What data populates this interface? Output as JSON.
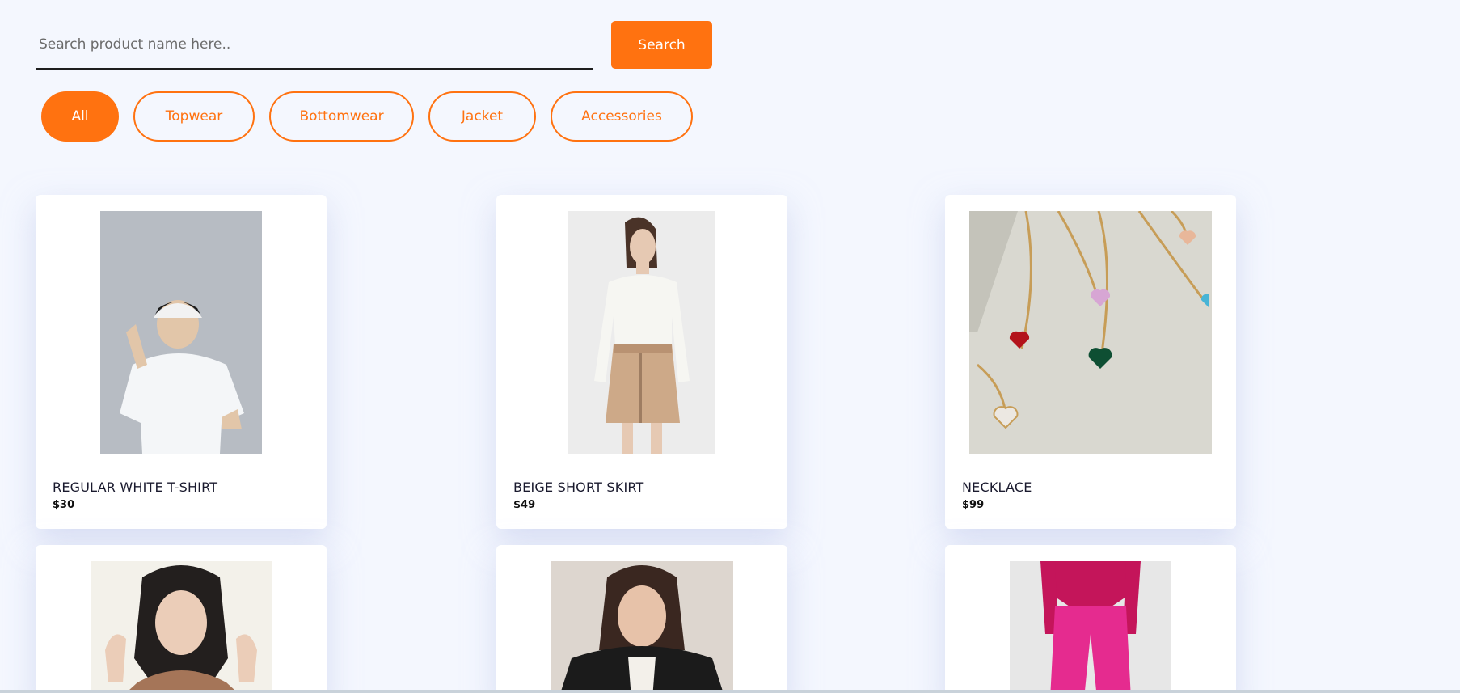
{
  "search": {
    "placeholder": "Search product name here..",
    "button_label": "Search"
  },
  "filters": [
    {
      "label": "All",
      "active": true
    },
    {
      "label": "Topwear",
      "active": false
    },
    {
      "label": "Bottomwear",
      "active": false
    },
    {
      "label": "Jacket",
      "active": false
    },
    {
      "label": "Accessories",
      "active": false
    }
  ],
  "products": [
    {
      "name": "REGULAR WHITE T-SHIRT",
      "price": "$30"
    },
    {
      "name": "BEIGE SHORT SKIRT",
      "price": "$49"
    },
    {
      "name": "NECKLACE",
      "price": "$99"
    },
    {
      "name": "",
      "price": ""
    },
    {
      "name": "",
      "price": ""
    },
    {
      "name": "",
      "price": ""
    }
  ],
  "colors": {
    "accent": "#ff7210",
    "background": "#f4f7fe",
    "card": "#ffffff"
  }
}
